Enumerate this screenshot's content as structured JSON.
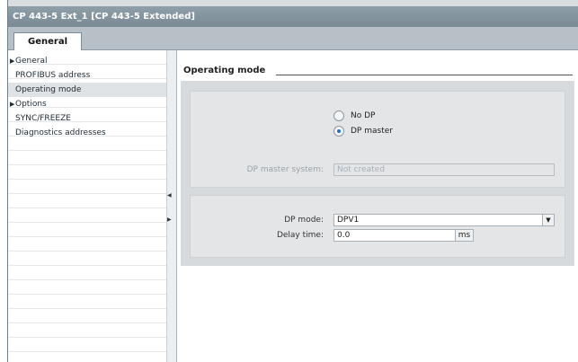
{
  "window": {
    "title": "CP 443-5 Ext_1 [CP 443-5 Extended]"
  },
  "tabs": [
    {
      "label": "General",
      "active": true
    }
  ],
  "nav": {
    "items": [
      {
        "label": "General",
        "expandable": true,
        "selected": false
      },
      {
        "label": "PROFIBUS address",
        "expandable": false,
        "selected": false
      },
      {
        "label": "Operating mode",
        "expandable": false,
        "selected": true
      },
      {
        "label": "Options",
        "expandable": true,
        "selected": false
      },
      {
        "label": "SYNC/FREEZE",
        "expandable": false,
        "selected": false
      },
      {
        "label": "Diagnostics addresses",
        "expandable": false,
        "selected": false
      }
    ]
  },
  "section": {
    "title": "Operating mode"
  },
  "mode": {
    "options": [
      {
        "label": "No DP",
        "selected": false
      },
      {
        "label": "DP master",
        "selected": true
      }
    ]
  },
  "dp_master_system": {
    "label": "DP master system:",
    "value": "Not created",
    "enabled": false
  },
  "dp_mode": {
    "label": "DP mode:",
    "value": "DPV1"
  },
  "delay_time": {
    "label": "Delay time:",
    "value": "0.0",
    "unit": "ms"
  },
  "icons": {
    "expand": "triangle-right-icon",
    "dropdown": "chevron-down-icon"
  },
  "colors": {
    "titlebar": "#7f8f9a",
    "selection": "#dfe3e6",
    "radio_accent": "#1e6fd9"
  }
}
